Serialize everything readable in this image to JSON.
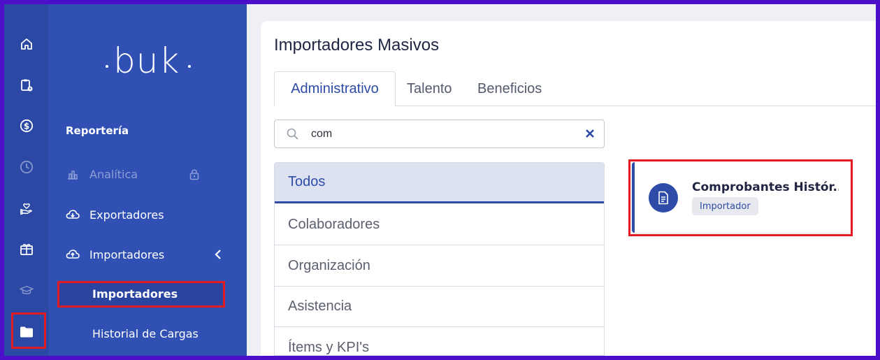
{
  "logo": {
    "text": "buk"
  },
  "rail": {
    "icons": [
      {
        "name": "home-icon"
      },
      {
        "name": "clipboard-clock-icon"
      },
      {
        "name": "dollar-icon"
      },
      {
        "name": "clock-icon"
      },
      {
        "name": "hand-heart-icon"
      },
      {
        "name": "gift-icon"
      },
      {
        "name": "graduation-cap-icon"
      },
      {
        "name": "folder-icon"
      }
    ]
  },
  "sidebar": {
    "section": "Reportería",
    "items": [
      {
        "label": "Analítica",
        "icon": "bar-chart-icon",
        "locked": true
      },
      {
        "label": "Exportadores",
        "icon": "cloud-download-icon"
      },
      {
        "label": "Importadores",
        "icon": "cloud-upload-icon"
      }
    ],
    "subitems": [
      {
        "label": "Importadores",
        "active": true
      },
      {
        "label": "Historial de Cargas"
      }
    ]
  },
  "main": {
    "title": "Importadores Masivos",
    "tabs": [
      {
        "label": "Administrativo",
        "active": true
      },
      {
        "label": "Talento"
      },
      {
        "label": "Beneficios"
      }
    ],
    "search": {
      "value": "com",
      "placeholder": ""
    },
    "categories": [
      {
        "label": "Todos",
        "active": true
      },
      {
        "label": "Colaboradores"
      },
      {
        "label": "Organización"
      },
      {
        "label": "Asistencia"
      },
      {
        "label": "Ítems y KPI's"
      }
    ],
    "result": {
      "title": "Comprobantes Histór...",
      "badge": "Importador",
      "icon": "document-icon"
    }
  },
  "colors": {
    "brand": "#2d4ba7",
    "sidebar": "#3050b4",
    "rail": "#2a48a4",
    "highlight": "#e21b23"
  }
}
